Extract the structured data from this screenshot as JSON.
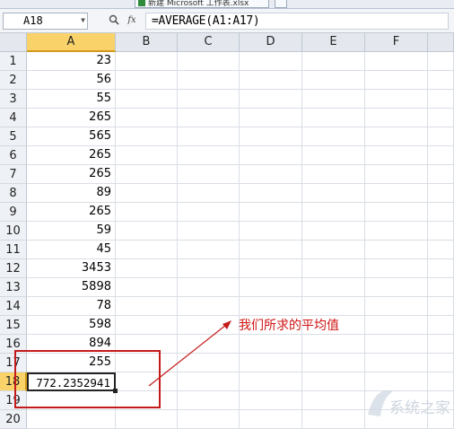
{
  "tabs": {
    "partial_tab_text": "新建 Microsoft 工作表.xlsx",
    "tab_icon": "excel-document-icon"
  },
  "formula_bar": {
    "name_box": "A18",
    "name_box_dropdown_icon": "chevron-down-icon",
    "zoom_icon": "magnifier-icon",
    "function_icon": "fx-icon",
    "function_label": "fx",
    "formula": "=AVERAGE(A1:A17)"
  },
  "columns": [
    "A",
    "B",
    "C",
    "D",
    "E",
    "F"
  ],
  "active_column": "A",
  "rows": [
    {
      "row": "1",
      "a": "23"
    },
    {
      "row": "2",
      "a": "56"
    },
    {
      "row": "3",
      "a": "55"
    },
    {
      "row": "4",
      "a": "265"
    },
    {
      "row": "5",
      "a": "565"
    },
    {
      "row": "6",
      "a": "265"
    },
    {
      "row": "7",
      "a": "265"
    },
    {
      "row": "8",
      "a": "89"
    },
    {
      "row": "9",
      "a": "265"
    },
    {
      "row": "10",
      "a": "59"
    },
    {
      "row": "11",
      "a": "45"
    },
    {
      "row": "12",
      "a": "3453"
    },
    {
      "row": "13",
      "a": "5898"
    },
    {
      "row": "14",
      "a": "78"
    },
    {
      "row": "15",
      "a": "598"
    },
    {
      "row": "16",
      "a": "894"
    },
    {
      "row": "17",
      "a": "255"
    },
    {
      "row": "18",
      "a": "772.2352941"
    },
    {
      "row": "19",
      "a": ""
    },
    {
      "row": "20",
      "a": ""
    }
  ],
  "selected_cell": "A18",
  "annotation": {
    "text": "我们所求的平均值",
    "color": "#d01414"
  },
  "watermark": {
    "text": "系统之家"
  },
  "colors": {
    "header_bg": "#e4e8ee",
    "active_header": "#f9d36a",
    "grid_line": "#d9dee5",
    "annotation_red": "#c41a1a"
  }
}
